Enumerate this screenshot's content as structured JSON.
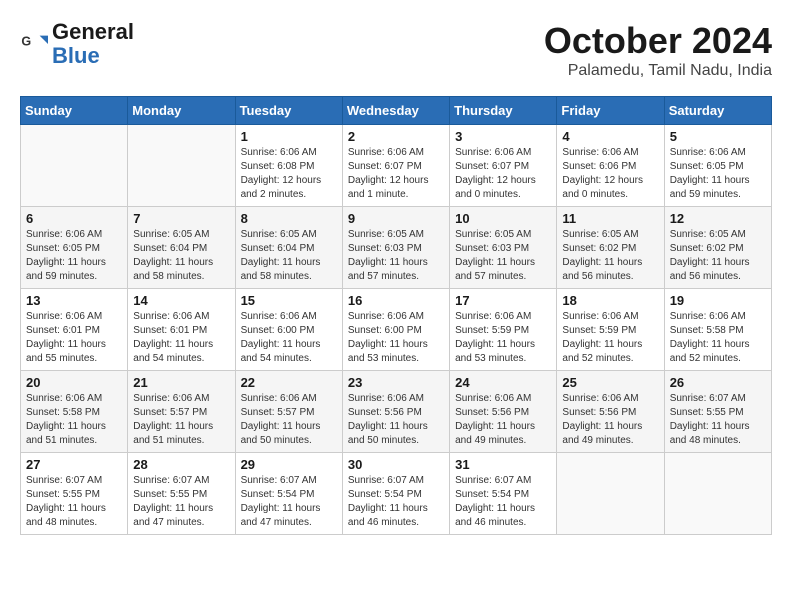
{
  "header": {
    "logo_general": "General",
    "logo_blue": "Blue",
    "month_title": "October 2024",
    "location": "Palamedu, Tamil Nadu, India"
  },
  "weekdays": [
    "Sunday",
    "Monday",
    "Tuesday",
    "Wednesday",
    "Thursday",
    "Friday",
    "Saturday"
  ],
  "weeks": [
    [
      {
        "day": "",
        "info": ""
      },
      {
        "day": "",
        "info": ""
      },
      {
        "day": "1",
        "info": "Sunrise: 6:06 AM\nSunset: 6:08 PM\nDaylight: 12 hours\nand 2 minutes."
      },
      {
        "day": "2",
        "info": "Sunrise: 6:06 AM\nSunset: 6:07 PM\nDaylight: 12 hours\nand 1 minute."
      },
      {
        "day": "3",
        "info": "Sunrise: 6:06 AM\nSunset: 6:07 PM\nDaylight: 12 hours\nand 0 minutes."
      },
      {
        "day": "4",
        "info": "Sunrise: 6:06 AM\nSunset: 6:06 PM\nDaylight: 12 hours\nand 0 minutes."
      },
      {
        "day": "5",
        "info": "Sunrise: 6:06 AM\nSunset: 6:05 PM\nDaylight: 11 hours\nand 59 minutes."
      }
    ],
    [
      {
        "day": "6",
        "info": "Sunrise: 6:06 AM\nSunset: 6:05 PM\nDaylight: 11 hours\nand 59 minutes."
      },
      {
        "day": "7",
        "info": "Sunrise: 6:05 AM\nSunset: 6:04 PM\nDaylight: 11 hours\nand 58 minutes."
      },
      {
        "day": "8",
        "info": "Sunrise: 6:05 AM\nSunset: 6:04 PM\nDaylight: 11 hours\nand 58 minutes."
      },
      {
        "day": "9",
        "info": "Sunrise: 6:05 AM\nSunset: 6:03 PM\nDaylight: 11 hours\nand 57 minutes."
      },
      {
        "day": "10",
        "info": "Sunrise: 6:05 AM\nSunset: 6:03 PM\nDaylight: 11 hours\nand 57 minutes."
      },
      {
        "day": "11",
        "info": "Sunrise: 6:05 AM\nSunset: 6:02 PM\nDaylight: 11 hours\nand 56 minutes."
      },
      {
        "day": "12",
        "info": "Sunrise: 6:05 AM\nSunset: 6:02 PM\nDaylight: 11 hours\nand 56 minutes."
      }
    ],
    [
      {
        "day": "13",
        "info": "Sunrise: 6:06 AM\nSunset: 6:01 PM\nDaylight: 11 hours\nand 55 minutes."
      },
      {
        "day": "14",
        "info": "Sunrise: 6:06 AM\nSunset: 6:01 PM\nDaylight: 11 hours\nand 54 minutes."
      },
      {
        "day": "15",
        "info": "Sunrise: 6:06 AM\nSunset: 6:00 PM\nDaylight: 11 hours\nand 54 minutes."
      },
      {
        "day": "16",
        "info": "Sunrise: 6:06 AM\nSunset: 6:00 PM\nDaylight: 11 hours\nand 53 minutes."
      },
      {
        "day": "17",
        "info": "Sunrise: 6:06 AM\nSunset: 5:59 PM\nDaylight: 11 hours\nand 53 minutes."
      },
      {
        "day": "18",
        "info": "Sunrise: 6:06 AM\nSunset: 5:59 PM\nDaylight: 11 hours\nand 52 minutes."
      },
      {
        "day": "19",
        "info": "Sunrise: 6:06 AM\nSunset: 5:58 PM\nDaylight: 11 hours\nand 52 minutes."
      }
    ],
    [
      {
        "day": "20",
        "info": "Sunrise: 6:06 AM\nSunset: 5:58 PM\nDaylight: 11 hours\nand 51 minutes."
      },
      {
        "day": "21",
        "info": "Sunrise: 6:06 AM\nSunset: 5:57 PM\nDaylight: 11 hours\nand 51 minutes."
      },
      {
        "day": "22",
        "info": "Sunrise: 6:06 AM\nSunset: 5:57 PM\nDaylight: 11 hours\nand 50 minutes."
      },
      {
        "day": "23",
        "info": "Sunrise: 6:06 AM\nSunset: 5:56 PM\nDaylight: 11 hours\nand 50 minutes."
      },
      {
        "day": "24",
        "info": "Sunrise: 6:06 AM\nSunset: 5:56 PM\nDaylight: 11 hours\nand 49 minutes."
      },
      {
        "day": "25",
        "info": "Sunrise: 6:06 AM\nSunset: 5:56 PM\nDaylight: 11 hours\nand 49 minutes."
      },
      {
        "day": "26",
        "info": "Sunrise: 6:07 AM\nSunset: 5:55 PM\nDaylight: 11 hours\nand 48 minutes."
      }
    ],
    [
      {
        "day": "27",
        "info": "Sunrise: 6:07 AM\nSunset: 5:55 PM\nDaylight: 11 hours\nand 48 minutes."
      },
      {
        "day": "28",
        "info": "Sunrise: 6:07 AM\nSunset: 5:55 PM\nDaylight: 11 hours\nand 47 minutes."
      },
      {
        "day": "29",
        "info": "Sunrise: 6:07 AM\nSunset: 5:54 PM\nDaylight: 11 hours\nand 47 minutes."
      },
      {
        "day": "30",
        "info": "Sunrise: 6:07 AM\nSunset: 5:54 PM\nDaylight: 11 hours\nand 46 minutes."
      },
      {
        "day": "31",
        "info": "Sunrise: 6:07 AM\nSunset: 5:54 PM\nDaylight: 11 hours\nand 46 minutes."
      },
      {
        "day": "",
        "info": ""
      },
      {
        "day": "",
        "info": ""
      }
    ]
  ]
}
